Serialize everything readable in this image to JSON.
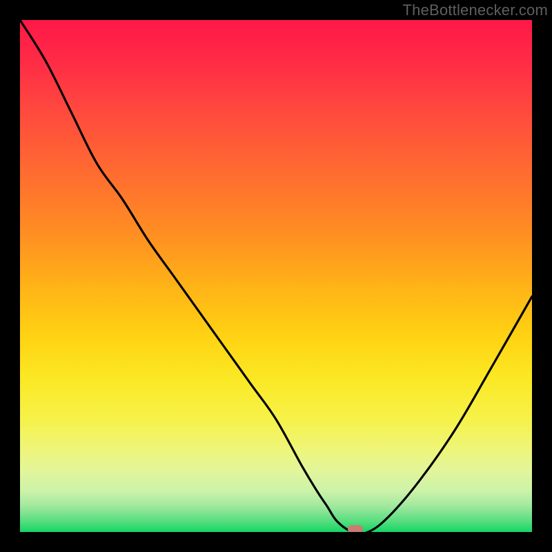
{
  "watermark": "TheBottlenecker.com",
  "chart_data": {
    "type": "line",
    "title": "",
    "xlabel": "",
    "ylabel": "",
    "xlim": [
      0,
      1
    ],
    "ylim": [
      0,
      100
    ],
    "x": [
      0.0,
      0.05,
      0.1,
      0.15,
      0.2,
      0.25,
      0.3,
      0.35,
      0.4,
      0.45,
      0.5,
      0.55,
      0.58,
      0.6,
      0.62,
      0.65,
      0.68,
      0.72,
      0.78,
      0.85,
      0.92,
      1.0
    ],
    "values": [
      100,
      92,
      82,
      72,
      65,
      57,
      50,
      43,
      36,
      29,
      22,
      13,
      8,
      5,
      2,
      0,
      0,
      3,
      10,
      20,
      32,
      46
    ],
    "marker": {
      "x": 0.655,
      "y": 0
    },
    "annotations": [
      "TheBottlenecker.com"
    ]
  },
  "colors": {
    "curve": "#000000",
    "marker": "#cc7a74",
    "frame": "#000000"
  }
}
